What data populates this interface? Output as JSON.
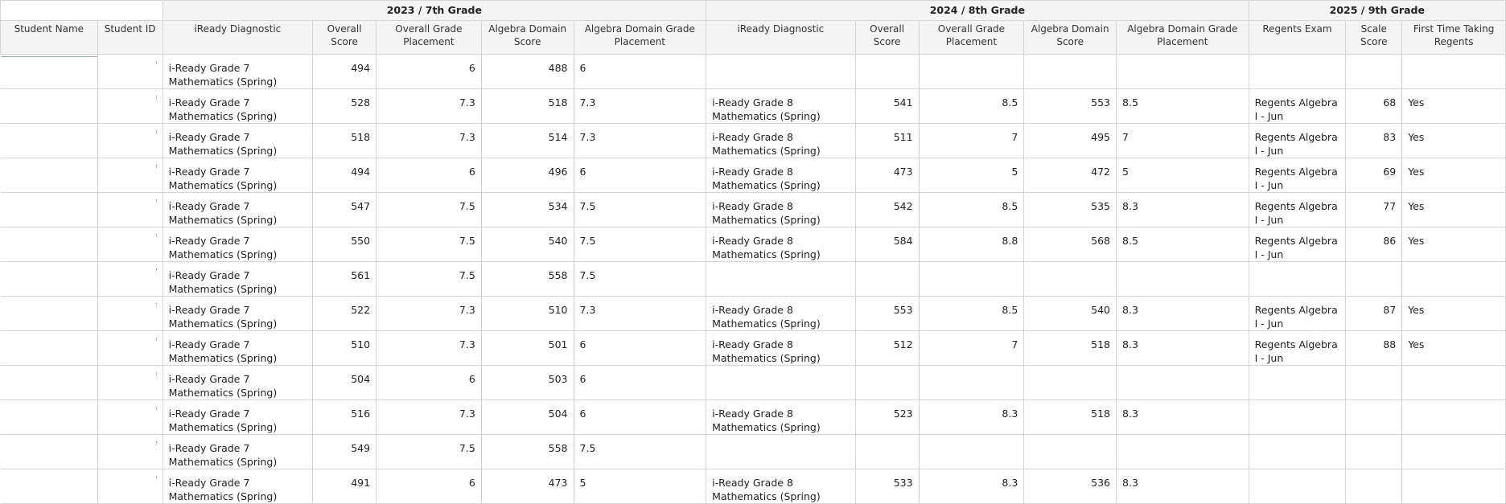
{
  "groups": [
    {
      "label": ""
    },
    {
      "label": "2023 / 7th Grade"
    },
    {
      "label": "2024 / 8th Grade"
    },
    {
      "label": "2025 / 9th Grade"
    }
  ],
  "columns": [
    {
      "key": "student_name",
      "label": "Student Name"
    },
    {
      "key": "student_id",
      "label": "Student ID"
    },
    {
      "key": "g7_iready",
      "label": "iReady Diagnostic"
    },
    {
      "key": "g7_overall",
      "label": "Overall Score"
    },
    {
      "key": "g7_ogp",
      "label": "Overall Grade Placement"
    },
    {
      "key": "g7_ads",
      "label": "Algebra Domain Score"
    },
    {
      "key": "g7_adgp",
      "label": "Algebra Domain Grade Placement"
    },
    {
      "key": "g8_iready",
      "label": "iReady Diagnostic"
    },
    {
      "key": "g8_overall",
      "label": "Overall Score"
    },
    {
      "key": "g8_ogp",
      "label": "Overall Grade Placement"
    },
    {
      "key": "g8_ads",
      "label": "Algebra Domain Score"
    },
    {
      "key": "g8_adgp",
      "label": "Algebra Domain Grade Placement"
    },
    {
      "key": "g9_exam",
      "label": "Regents Exam"
    },
    {
      "key": "g9_scale",
      "label": "Scale Score"
    },
    {
      "key": "g9_first",
      "label": "First Time Taking Regents"
    }
  ],
  "rows": [
    [
      "",
      "",
      "i-Ready Grade 7 Mathematics (Spring)",
      "494",
      "6",
      "488",
      "6",
      "",
      "",
      "",
      "",
      "",
      "",
      "",
      ""
    ],
    [
      "",
      "",
      "i-Ready Grade 7 Mathematics (Spring)",
      "528",
      "7.3",
      "518",
      "7.3",
      "i-Ready Grade 8 Mathematics (Spring)",
      "541",
      "8.5",
      "553",
      "8.5",
      "Regents Algebra I - Jun",
      "68",
      "Yes"
    ],
    [
      "",
      "",
      "i-Ready Grade 7 Mathematics (Spring)",
      "518",
      "7.3",
      "514",
      "7.3",
      "i-Ready Grade 8 Mathematics (Spring)",
      "511",
      "7",
      "495",
      "7",
      "Regents Algebra I - Jun",
      "83",
      "Yes"
    ],
    [
      "",
      "",
      "i-Ready Grade 7 Mathematics (Spring)",
      "494",
      "6",
      "496",
      "6",
      "i-Ready Grade 8 Mathematics (Spring)",
      "473",
      "5",
      "472",
      "5",
      "Regents Algebra I - Jun",
      "69",
      "Yes"
    ],
    [
      "",
      "",
      "i-Ready Grade 7 Mathematics (Spring)",
      "547",
      "7.5",
      "534",
      "7.5",
      "i-Ready Grade 8 Mathematics (Spring)",
      "542",
      "8.5",
      "535",
      "8.3",
      "Regents Algebra I - Jun",
      "77",
      "Yes"
    ],
    [
      "",
      "",
      "i-Ready Grade 7 Mathematics (Spring)",
      "550",
      "7.5",
      "540",
      "7.5",
      "i-Ready Grade 8 Mathematics (Spring)",
      "584",
      "8.8",
      "568",
      "8.5",
      "Regents Algebra I - Jun",
      "86",
      "Yes"
    ],
    [
      "",
      "",
      "i-Ready Grade 7 Mathematics (Spring)",
      "561",
      "7.5",
      "558",
      "7.5",
      "",
      "",
      "",
      "",
      "",
      "",
      "",
      ""
    ],
    [
      "",
      "",
      "i-Ready Grade 7 Mathematics (Spring)",
      "522",
      "7.3",
      "510",
      "7.3",
      "i-Ready Grade 8 Mathematics (Spring)",
      "553",
      "8.5",
      "540",
      "8.3",
      "Regents Algebra I - Jun",
      "87",
      "Yes"
    ],
    [
      "",
      "",
      "i-Ready Grade 7 Mathematics (Spring)",
      "510",
      "7.3",
      "501",
      "6",
      "i-Ready Grade 8 Mathematics (Spring)",
      "512",
      "7",
      "518",
      "8.3",
      "Regents Algebra I - Jun",
      "88",
      "Yes"
    ],
    [
      "",
      "",
      "i-Ready Grade 7 Mathematics (Spring)",
      "504",
      "6",
      "503",
      "6",
      "",
      "",
      "",
      "",
      "",
      "",
      "",
      ""
    ],
    [
      "",
      "",
      "i-Ready Grade 7 Mathematics (Spring)",
      "516",
      "7.3",
      "504",
      "6",
      "i-Ready Grade 8 Mathematics (Spring)",
      "523",
      "8.3",
      "518",
      "8.3",
      "",
      "",
      ""
    ],
    [
      "",
      "",
      "i-Ready Grade 7 Mathematics (Spring)",
      "549",
      "7.5",
      "558",
      "7.5",
      "",
      "",
      "",
      "",
      "",
      "",
      "",
      ""
    ],
    [
      "",
      "",
      "i-Ready Grade 7 Mathematics (Spring)",
      "491",
      "6",
      "473",
      "5",
      "i-Ready Grade 8 Mathematics (Spring)",
      "533",
      "8.3",
      "536",
      "8.3",
      "",
      "",
      ""
    ]
  ]
}
